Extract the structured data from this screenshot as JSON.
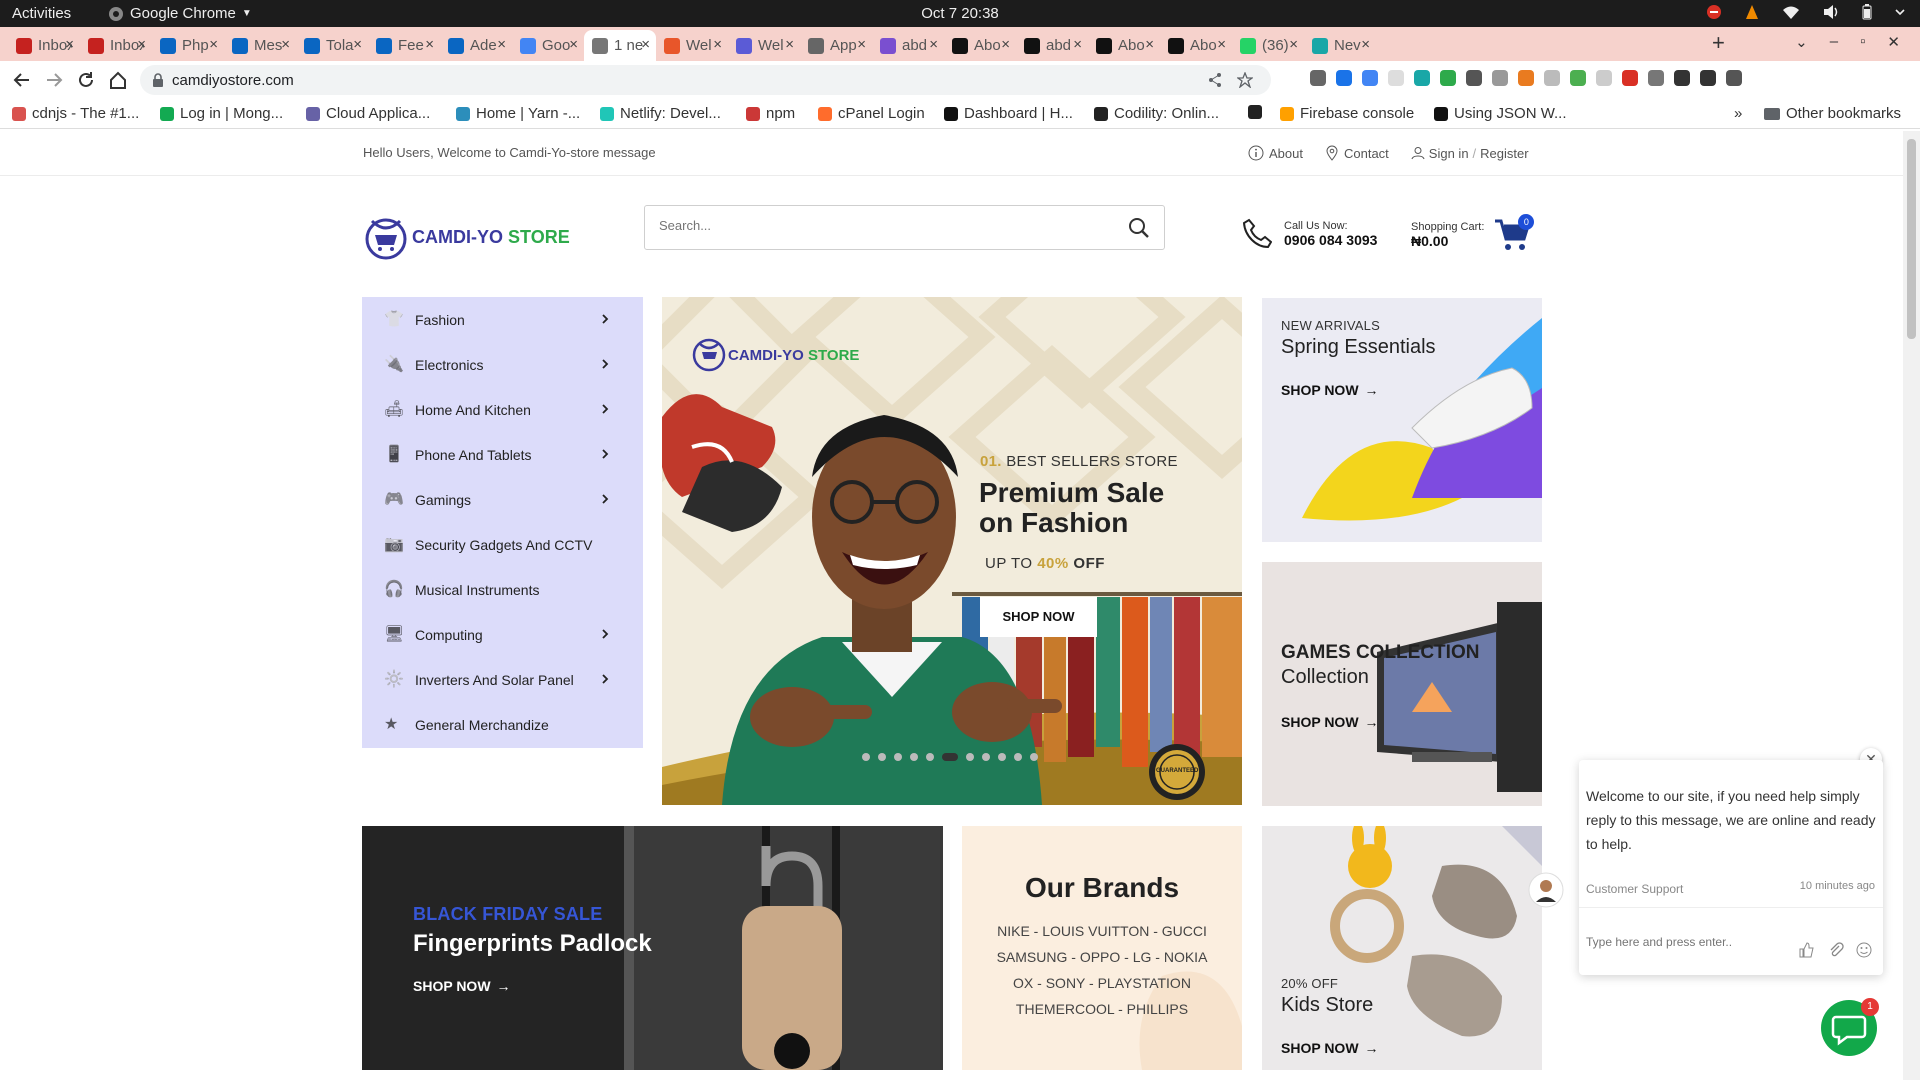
{
  "os": {
    "activities": "Activities",
    "app_name": "Google Chrome",
    "clock": "Oct 7  20:38"
  },
  "tabs": [
    {
      "title": "Inbox",
      "color": "#c5221f",
      "icon": "gmail-icon"
    },
    {
      "title": "Inbox",
      "color": "#c5221f",
      "icon": "gmail-icon"
    },
    {
      "title": "Php",
      "color": "#0a66c2",
      "icon": "linkedin-icon"
    },
    {
      "title": "Mes",
      "color": "#0a66c2",
      "icon": "linkedin-icon"
    },
    {
      "title": "Tola",
      "color": "#0a66c2",
      "icon": "linkedin-icon"
    },
    {
      "title": "Fee",
      "color": "#0a66c2",
      "icon": "linkedin-icon"
    },
    {
      "title": "Ade",
      "color": "#0a66c2",
      "icon": "linkedin-icon"
    },
    {
      "title": "Goo",
      "color": "#4285f4",
      "icon": "google-icon"
    },
    {
      "title": "1 ne",
      "color": "#777",
      "icon": "site-icon",
      "active": true
    },
    {
      "title": "Wel",
      "color": "#e8562a",
      "icon": "site-icon"
    },
    {
      "title": "Wel",
      "color": "#5b5bd6",
      "icon": "site-icon"
    },
    {
      "title": "App",
      "color": "#666",
      "icon": "site-icon"
    },
    {
      "title": "abd",
      "color": "#7a4fd0",
      "icon": "heroku-icon"
    },
    {
      "title": "Abo",
      "color": "#111",
      "icon": "site-icon"
    },
    {
      "title": "abd",
      "color": "#111",
      "icon": "github-icon"
    },
    {
      "title": "Abo",
      "color": "#111",
      "icon": "site-icon"
    },
    {
      "title": "Abo",
      "color": "#111",
      "icon": "site-icon"
    },
    {
      "title": "(36)",
      "color": "#25d366",
      "icon": "whatsapp-icon"
    },
    {
      "title": "Nev",
      "color": "#19a7a7",
      "icon": "site-icon"
    }
  ],
  "address": {
    "url": "camdiyostore.com"
  },
  "bookmarks": [
    {
      "label": "cdnjs - The #1...",
      "color": "#d9534f"
    },
    {
      "label": "Log in | Mong...",
      "color": "#13aa52"
    },
    {
      "label": "Cloud Applica...",
      "color": "#6762a6"
    },
    {
      "label": "Home | Yarn -...",
      "color": "#2c8ebb"
    },
    {
      "label": "Netlify: Devel...",
      "color": "#20c6b7"
    },
    {
      "label": "npm",
      "color": "#cb3837"
    },
    {
      "label": "cPanel Login",
      "color": "#ff6c2c"
    },
    {
      "label": "Dashboard | H...",
      "color": "#111"
    },
    {
      "label": "Codility: Onlin...",
      "color": "#222"
    },
    {
      "label": "",
      "color": "#222"
    },
    {
      "label": "Firebase console",
      "color": "#ffa000"
    },
    {
      "label": "Using JSON W...",
      "color": "#111"
    }
  ],
  "bookmarks_other": "Other bookmarks",
  "site": {
    "welcome": "Hello Users, Welcome to Camdi-Yo-store message",
    "links": {
      "about": "About",
      "contact": "Contact",
      "signin": "Sign in",
      "slash": "/",
      "register": "Register"
    },
    "logo_a": "CAMDI-YO",
    "logo_b": "STORE",
    "search_placeholder": "Search...",
    "call_label": "Call Us Now:",
    "call_number": "0906 084 3093",
    "cart_label": "Shopping Cart:",
    "cart_total": "₦0.00",
    "cart_count": "0",
    "categories": [
      {
        "label": "Fashion",
        "sub": true,
        "icon": "shirt-icon"
      },
      {
        "label": "Electronics",
        "sub": true,
        "icon": "plug-icon"
      },
      {
        "label": "Home And Kitchen",
        "sub": true,
        "icon": "sofa-icon"
      },
      {
        "label": "Phone And Tablets",
        "sub": true,
        "icon": "phone-icon"
      },
      {
        "label": "Gamings",
        "sub": true,
        "icon": "gamepad-icon"
      },
      {
        "label": "Security Gadgets And CCTV",
        "sub": false,
        "icon": "camera-icon"
      },
      {
        "label": "Musical Instruments",
        "sub": false,
        "icon": "headphones-icon"
      },
      {
        "label": "Computing",
        "sub": true,
        "icon": "monitor-icon"
      },
      {
        "label": "Inverters And Solar Panel",
        "sub": true,
        "icon": "solar-icon"
      },
      {
        "label": "General Merchandize",
        "sub": false,
        "icon": "star-icon"
      }
    ],
    "hero": {
      "logo_a": "CAMDI-YO",
      "logo_b": "STORE",
      "number": "01.",
      "kicker": "BEST SELLERS STORE",
      "title1": "Premium Sale",
      "title2": "on Fashion",
      "offer_pre": "UP TO",
      "offer_pct": "40%",
      "offer_post": "OFF",
      "button": "SHOP NOW",
      "dots": 11,
      "active_dot": 5,
      "seal": "GUARANTEED"
    },
    "banner_spring": {
      "sub": "NEW ARRIVALS",
      "title": "Spring Essentials",
      "shop": "SHOP NOW"
    },
    "banner_games": {
      "title1": "GAMES COLLECTION",
      "title2": "Collection",
      "shop": "SHOP NOW"
    },
    "banner_padlock": {
      "sub": "BLACK FRIDAY SALE",
      "title": "Fingerprints Padlock",
      "shop": "SHOP NOW"
    },
    "brands": {
      "title": "Our Brands",
      "lines": [
        "NIKE - LOUIS VUITTON - GUCCI",
        "SAMSUNG - OPPO - LG - NOKIA",
        "OX - SONY - PLAYSTATION",
        "THEMERCOOL - PHILLIPS"
      ]
    },
    "banner_kids": {
      "sub": "20% OFF",
      "title": "Kids Store",
      "shop": "SHOP NOW"
    }
  },
  "chat": {
    "message": "Welcome to our site, if you need help simply reply to this message, we are online and ready to help.",
    "agent": "Customer Support",
    "time": "10 minutes ago",
    "placeholder": "Type here and press enter..",
    "unread": "1"
  },
  "colors": {
    "accent_blue": "#3a3a9e",
    "accent_green": "#2eaa4b",
    "sidebar": "#dcdcfa",
    "chat_green": "#12a84a"
  }
}
